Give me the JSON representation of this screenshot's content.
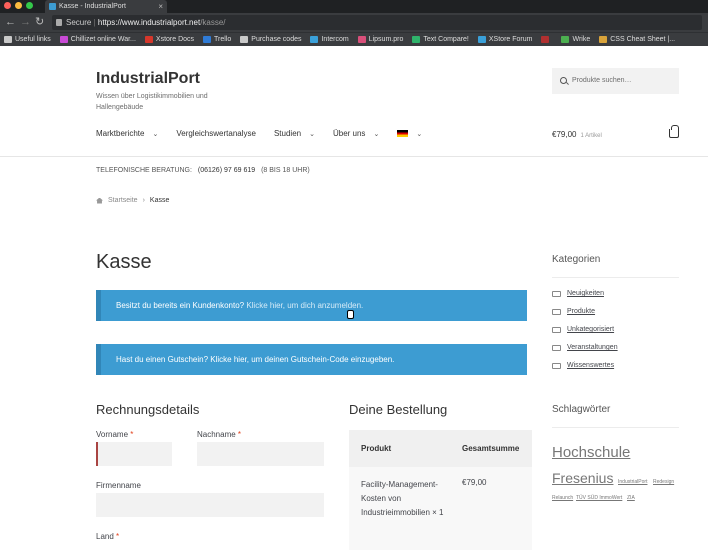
{
  "browser": {
    "tab_title": "Kasse - IndustrialPort",
    "tab_close": "×",
    "secure_label": "Secure",
    "url_host": "https://www.industrialport.net",
    "url_path": "/kasse/",
    "bookmarks": [
      {
        "label": "Useful links",
        "color": "#c9c9c9"
      },
      {
        "label": "Chillizet online War...",
        "color": "#c94ad6"
      },
      {
        "label": "Xstore Docs",
        "color": "#d6372b"
      },
      {
        "label": "Trello",
        "color": "#2f7bd6"
      },
      {
        "label": "Purchase codes",
        "color": "#c9c9c9"
      },
      {
        "label": "Intercom",
        "color": "#3aa0d9"
      },
      {
        "label": "Lipsum.pro",
        "color": "#d94f7a"
      },
      {
        "label": "Text Compare!",
        "color": "#2fb36b"
      },
      {
        "label": "XStore Forum",
        "color": "#3aa0d9"
      },
      {
        "label": "",
        "color": "#b03030"
      },
      {
        "label": "Wrike",
        "color": "#4caf50"
      },
      {
        "label": "CSS Cheat Sheet |...",
        "color": "#d9a33a"
      }
    ]
  },
  "site": {
    "logo": "IndustrialPort",
    "tagline": "Wissen über Logistikimmobilien und Hallengebäude",
    "search_placeholder": "Produkte suchen…",
    "menu": [
      "Marktberichte",
      "Vergleichswertanalyse",
      "Studien",
      "Über uns"
    ],
    "cart_total": "€79,00",
    "cart_count": "1 Artikel",
    "phone_label": "TELEFONISCHE BERATUNG:",
    "phone_number": "(06126) 97 69 619",
    "phone_hours": "(8 BIS 18 UHR)",
    "breadcrumb_home": "Startseite",
    "breadcrumb_sep": "›",
    "breadcrumb_current": "Kasse"
  },
  "checkout": {
    "title": "Kasse",
    "login_notice_text": "Besitzt du bereits ein Kundenkonto? ",
    "login_notice_link": "Klicke hier, um dich anzumelden.",
    "coupon_notice": "Hast du einen Gutschein? Klicke hier, um deinen Gutschein-Code einzugeben.",
    "billing_title": "Rechnungsdetails",
    "fields": {
      "first_name": "Vorname",
      "last_name": "Nachname",
      "company": "Firmenname",
      "country": "Land",
      "required_mark": "*"
    },
    "order_title": "Deine Bestellung",
    "order_col_product": "Produkt",
    "order_col_total": "Gesamtsumme",
    "order_item_name": "Facility-Management-Kosten von Industrieimmobilien × 1",
    "order_item_price": "€79,00"
  },
  "sidebar": {
    "categories_title": "Kategorien",
    "categories": [
      "Neuigkeiten",
      "Produkte",
      "Unkategorisiert",
      "Veranstaltungen",
      "Wissenswertes"
    ],
    "tags_title": "Schlagwörter",
    "tags": [
      "Hochschule",
      "Fresenius",
      "IndustrialPort",
      "Redesign",
      "Relaunch",
      "TÜV SÜD ImmoWert",
      "ZIA"
    ]
  }
}
